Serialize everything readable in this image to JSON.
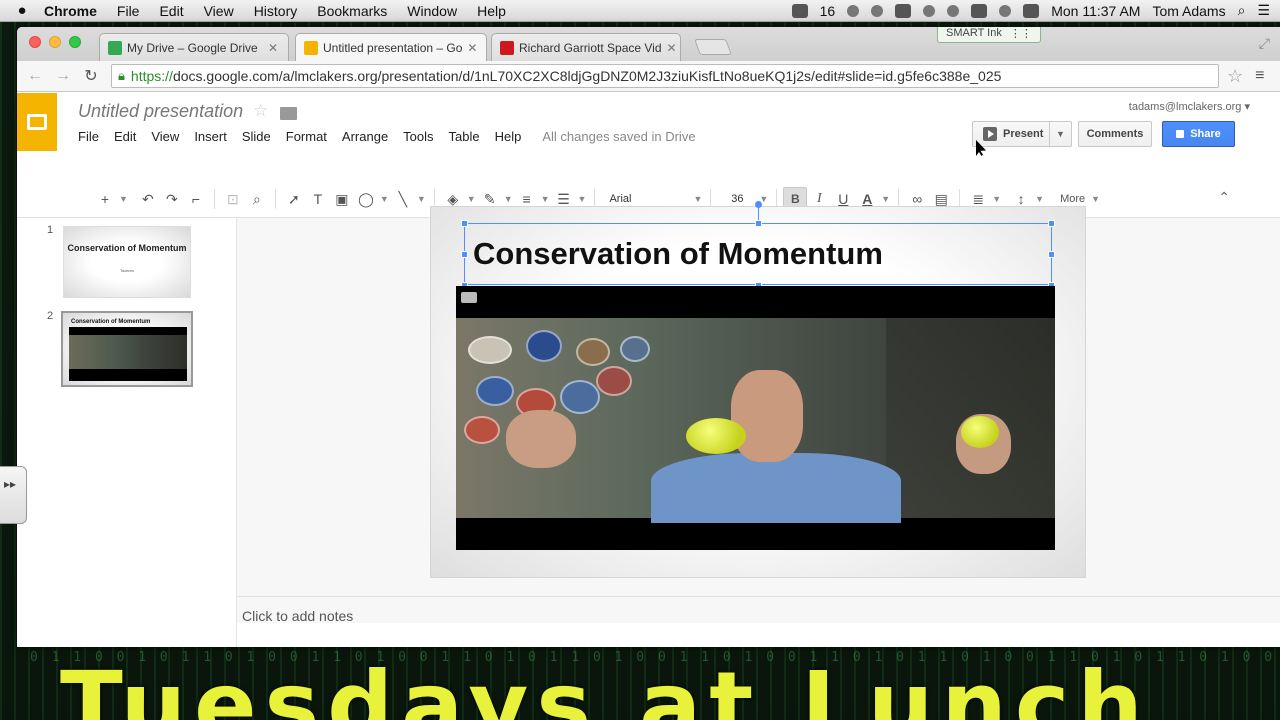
{
  "menubar": {
    "apple": "",
    "app": "Chrome",
    "items": [
      "File",
      "Edit",
      "View",
      "History",
      "Bookmarks",
      "Window",
      "Help"
    ],
    "status_number": "16",
    "clock": "Mon 11:37 AM",
    "user": "Tom Adams"
  },
  "browser": {
    "tabs": [
      {
        "label": "My Drive – Google Drive",
        "favicon_color": "#34a853"
      },
      {
        "label": "Untitled presentation – Go",
        "favicon_color": "#f4b400"
      },
      {
        "label": "Richard Garriott Space Vid",
        "favicon_color": "#cc181e"
      }
    ],
    "close_glyph": "✕",
    "smart_ink": "SMART Ink",
    "url_scheme": "https://",
    "url_rest": "docs.google.com/a/lmclakers.org/presentation/d/1nL70XC2XC8ldjGgDNZ0M2J3ziuKisfLtNo8ueKQ1j2s/edit#slide=id.g5fe6c388e_025"
  },
  "slides_app": {
    "doc_title": "Untitled presentation",
    "account": "tadams@lmclakers.org ▾",
    "menus": [
      "File",
      "Edit",
      "View",
      "Insert",
      "Slide",
      "Format",
      "Arrange",
      "Tools",
      "Table",
      "Help"
    ],
    "save_status": "All changes saved in Drive",
    "present_label": "Present",
    "comments_label": "Comments",
    "share_label": "Share",
    "toolbar": {
      "font": "Arial",
      "font_size": "36",
      "bold": "B",
      "italic": "I",
      "underline": "U",
      "text_color": "A",
      "more": "More"
    },
    "thumbnails": [
      {
        "num": "1",
        "title": "Conservation of Momentum",
        "subtitle": "Tadams"
      },
      {
        "num": "2",
        "title": "Conservation of Momentum"
      }
    ],
    "slide_title": "Conservation of Momentum",
    "notes_placeholder": "Click to add notes"
  },
  "overlay": {
    "banner": "Tuesdays at Lunch"
  },
  "colors": {
    "accent_blue": "#4d90fe",
    "slides_yellow": "#f4b400",
    "banner_yellow": "#e8f23a"
  }
}
